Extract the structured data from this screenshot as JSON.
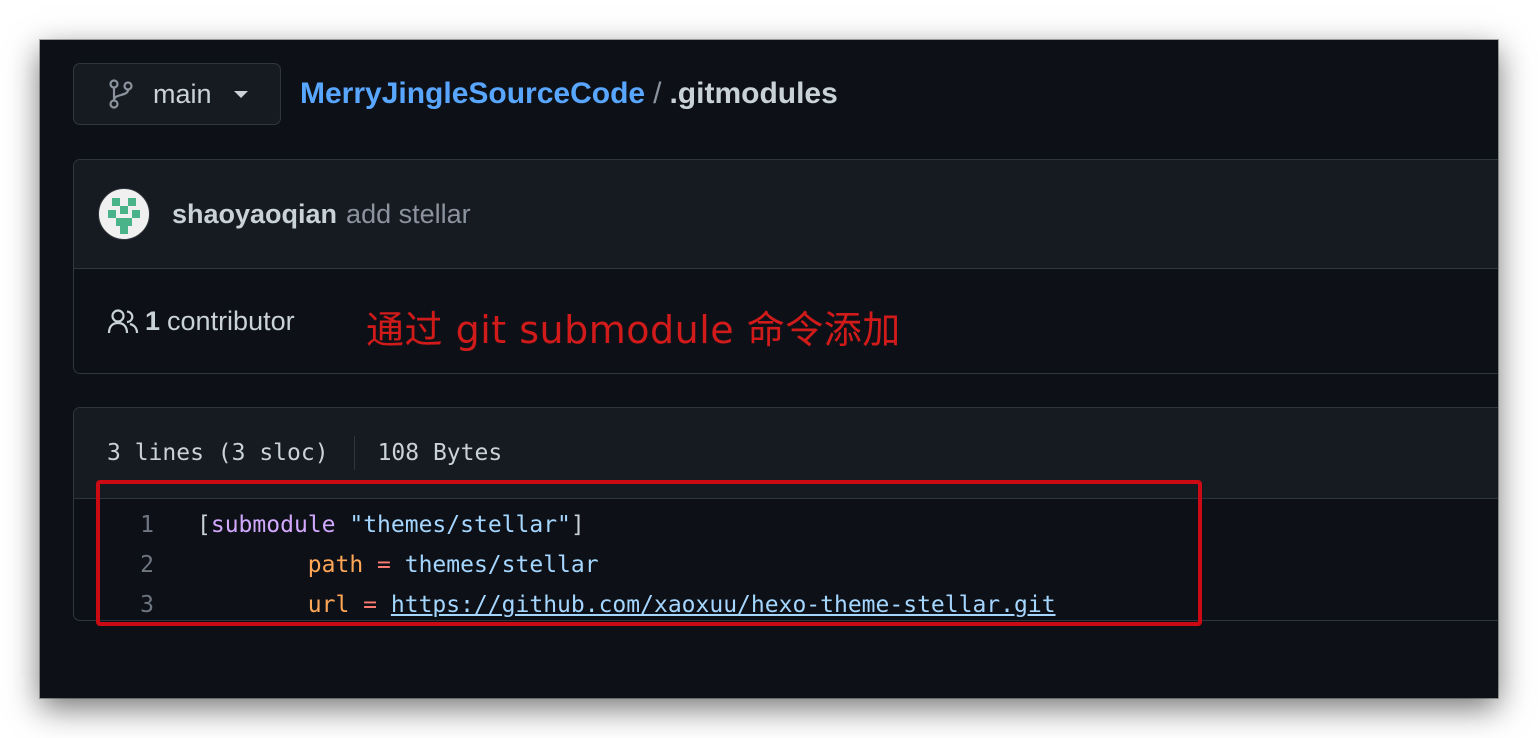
{
  "branch": {
    "name": "main",
    "icon": "git-branch-icon"
  },
  "breadcrumb": {
    "repo": "MerryJingleSourceCode",
    "separator": "/",
    "file": ".gitmodules"
  },
  "commit": {
    "author": "shaoyaoqian",
    "message": "add stellar"
  },
  "contributors": {
    "count": "1",
    "label": "contributor",
    "icon": "people-icon"
  },
  "annotation": {
    "text": "通过 git  submodule 命令添加",
    "color": "#d11a1a"
  },
  "file_info": {
    "lines": "3 lines (3 sloc)",
    "size": "108 Bytes"
  },
  "code": {
    "lines": [
      {
        "number": "1",
        "open_bracket": "[",
        "section": "submodule",
        "space": " ",
        "name": "\"themes/stellar\"",
        "close_bracket": "]"
      },
      {
        "number": "2",
        "indent": "        ",
        "key": "path",
        "op": " = ",
        "value": "themes/stellar"
      },
      {
        "number": "3",
        "indent": "        ",
        "key": "url",
        "op": " = ",
        "value": "https://github.com/xaoxuu/hexo-theme-stellar.git"
      }
    ]
  },
  "colors": {
    "background": "#0d1117",
    "link": "#58a6ff",
    "highlight_border": "#cc0a14"
  }
}
